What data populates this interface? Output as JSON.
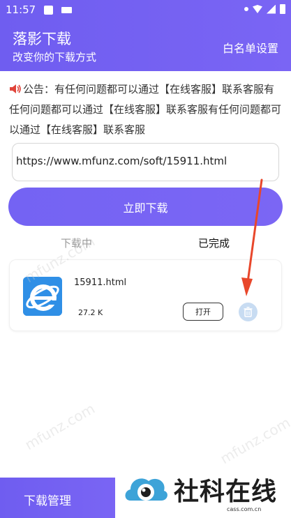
{
  "status_bar": {
    "time": "11:57"
  },
  "header": {
    "title": "落影下载",
    "subtitle": "改变你的下载方式",
    "whitelist_label": "白名单设置"
  },
  "notice": {
    "text": "公告：有任何问题都可以通过【在线客服】联系客服有任何问题都可以通过【在线客服】联系客服有任何问题都可以通过【在线客服】联系客服",
    "icon": "speaker-icon"
  },
  "url_input": {
    "value": "https://www.mfunz.com/soft/15911.html"
  },
  "download_button": {
    "label": "立即下载"
  },
  "tabs": [
    {
      "label": "下载中",
      "active": false
    },
    {
      "label": "已完成",
      "active": true
    }
  ],
  "files": [
    {
      "name": "15911.html",
      "size": "27.2 K",
      "open_label": "打开",
      "icon": "ie-icon"
    }
  ],
  "bottom_nav": {
    "label": "下载管理"
  },
  "watermark": {
    "logo_text": "社科在线",
    "domain": "cass.com.cn",
    "overlay_text": "mfunz.com"
  },
  "colors": {
    "primary": "#7463f3",
    "annotation_arrow": "#e8472b",
    "delete_bg": "#c8dcf2"
  }
}
